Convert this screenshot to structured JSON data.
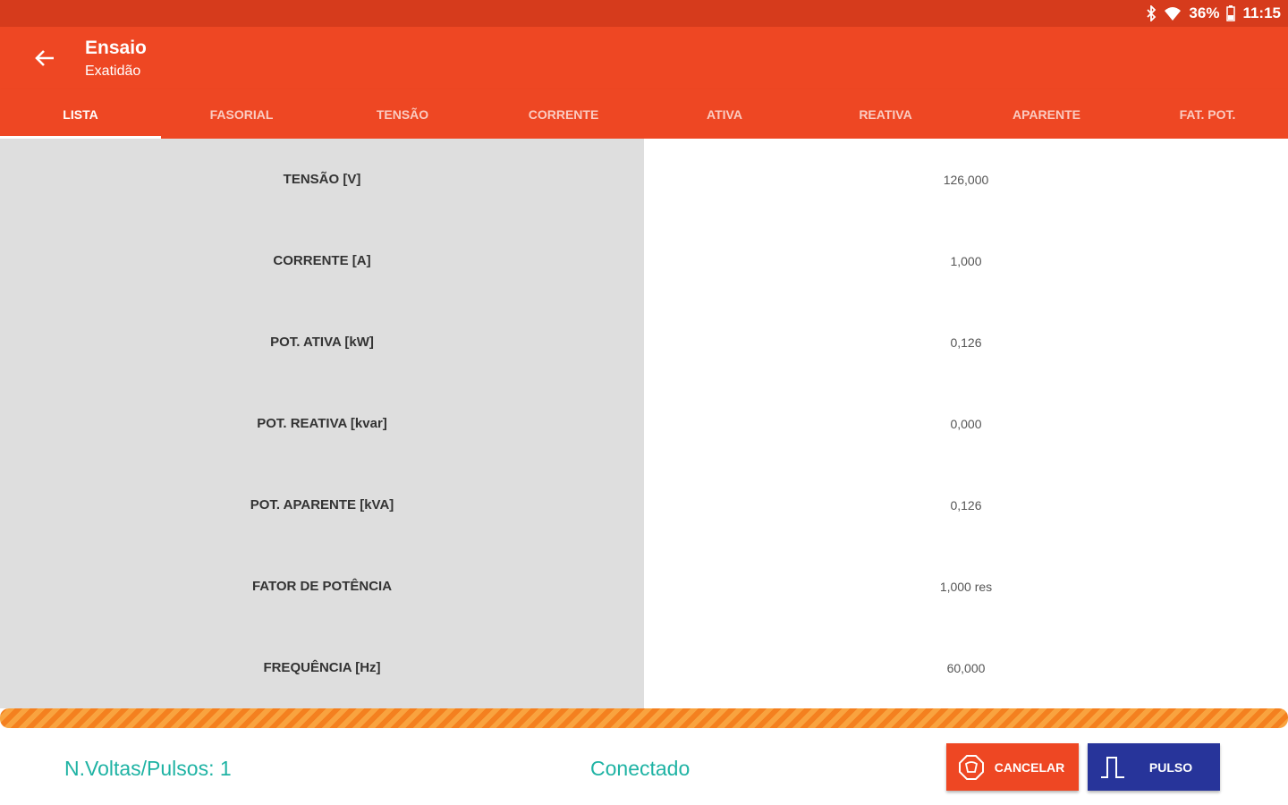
{
  "status_bar": {
    "battery": "36%",
    "time": "11:15"
  },
  "app_bar": {
    "title": "Ensaio",
    "subtitle": "Exatidão"
  },
  "tabs": [
    {
      "label": "LISTA",
      "active": true
    },
    {
      "label": "FASORIAL",
      "active": false
    },
    {
      "label": "TENSÃO",
      "active": false
    },
    {
      "label": "CORRENTE",
      "active": false
    },
    {
      "label": "ATIVA",
      "active": false
    },
    {
      "label": "REATIVA",
      "active": false
    },
    {
      "label": "APARENTE",
      "active": false
    },
    {
      "label": "FAT. POT.",
      "active": false
    }
  ],
  "table": {
    "rows": [
      {
        "label": "TENSÃO [V]",
        "value": "126,000"
      },
      {
        "label": "CORRENTE [A]",
        "value": "1,000"
      },
      {
        "label": "POT. ATIVA [kW]",
        "value": "0,126"
      },
      {
        "label": "POT. REATIVA [kvar]",
        "value": "0,000"
      },
      {
        "label": "POT. APARENTE [kVA]",
        "value": "0,126"
      },
      {
        "label": "FATOR DE POTÊNCIA",
        "value": "1,000 res"
      },
      {
        "label": "FREQUÊNCIA [Hz]",
        "value": "60,000"
      }
    ]
  },
  "footer": {
    "pulses": "N.Voltas/Pulsos: 1",
    "connection": "Conectado",
    "cancel_label": "CANCELAR",
    "pulse_label": "PULSO"
  },
  "colors": {
    "primary": "#ee4723",
    "status_bar": "#d63b1c",
    "accent_teal": "#1fb3a4",
    "pulse_button": "#27349a",
    "progress": "#f4801f"
  }
}
